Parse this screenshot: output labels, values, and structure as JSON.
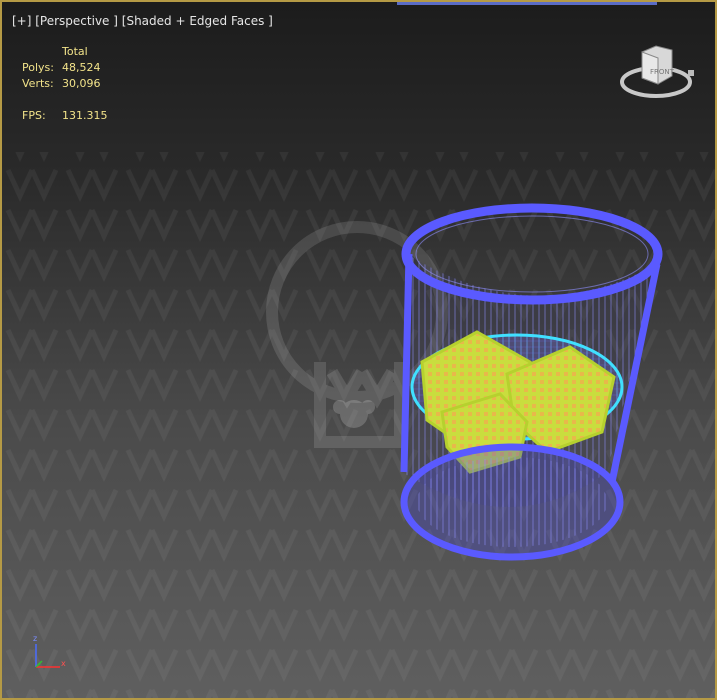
{
  "viewport": {
    "menu_label": "[+]",
    "view_label": "[Perspective ]",
    "shading_label": "[Shaded + Edged Faces ]"
  },
  "stats": {
    "header": "Total",
    "polys_label": "Polys:",
    "polys_value": "48,524",
    "verts_label": "Verts:",
    "verts_value": "30,096",
    "fps_label": "FPS:",
    "fps_value": "131.315"
  },
  "viewcube": {
    "face_label": "FRONT"
  },
  "axis": {
    "z_label": "z",
    "x_label": "x",
    "y_label": "y"
  },
  "colors": {
    "viewport_border": "#b59a45",
    "glass_wire": "#5a5aff",
    "liquid_wire": "#40e0ff",
    "ice_cube": "#c8e040",
    "stats_text": "#f2e38a"
  }
}
